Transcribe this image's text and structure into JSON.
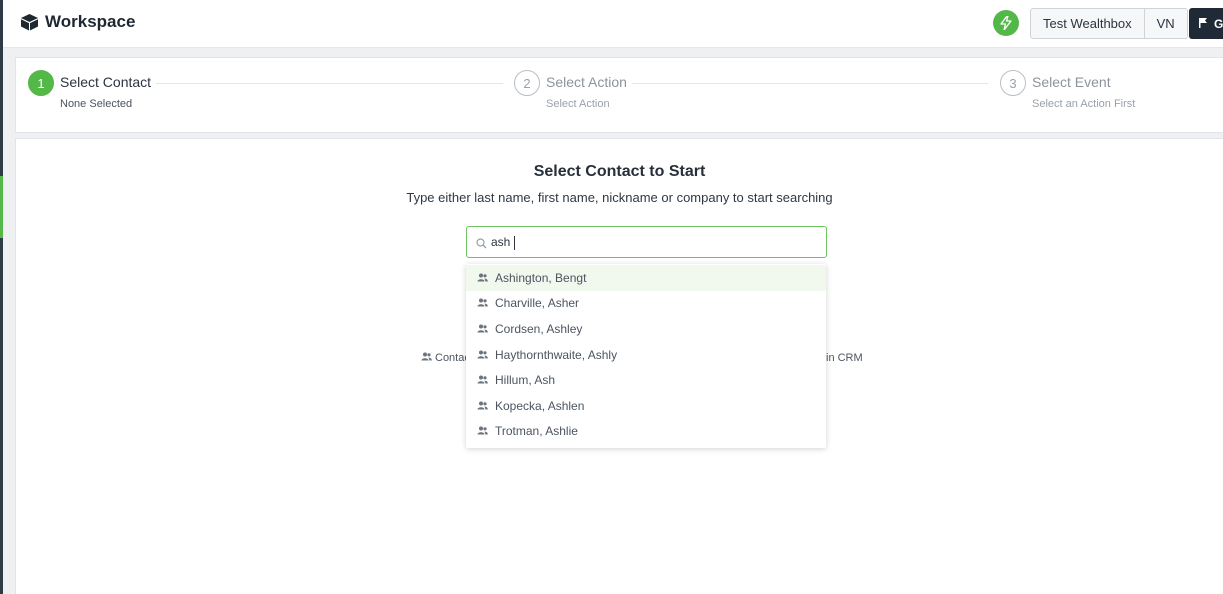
{
  "header": {
    "app_title": "Workspace",
    "user_button": "Test Wealthbox",
    "initials_button": "VN",
    "dark_button_label": "G",
    "colors": {
      "accent": "#54b848",
      "dark": "#1f2a36"
    }
  },
  "stepper": {
    "steps": [
      {
        "number": "1",
        "title": "Select Contact",
        "subtitle": "None Selected",
        "active": true
      },
      {
        "number": "2",
        "title": "Select Action",
        "subtitle": "Select Action",
        "active": false
      },
      {
        "number": "3",
        "title": "Select Event",
        "subtitle": "Select an Action First",
        "active": false
      }
    ]
  },
  "main": {
    "title": "Select Contact to Start",
    "subtitle": "Type either last name, first name, nickname or company to start searching",
    "search": {
      "value": "ash",
      "placeholder": ""
    },
    "hint_left": "Contac",
    "hint_right": "in CRM"
  },
  "dropdown": {
    "items": [
      {
        "label": "Ashington, Bengt",
        "icon": "contact-icon"
      },
      {
        "label": "Charville, Asher",
        "icon": "contact-icon"
      },
      {
        "label": "Cordsen, Ashley",
        "icon": "contact-icon"
      },
      {
        "label": "Haythornthwaite, Ashly",
        "icon": "contact-icon"
      },
      {
        "label": "Hillum, Ash",
        "icon": "contact-icon"
      },
      {
        "label": "Kopecka, Ashlen",
        "icon": "contact-icon"
      },
      {
        "label": "Trotman, Ashlie",
        "icon": "contact-icon"
      }
    ]
  }
}
